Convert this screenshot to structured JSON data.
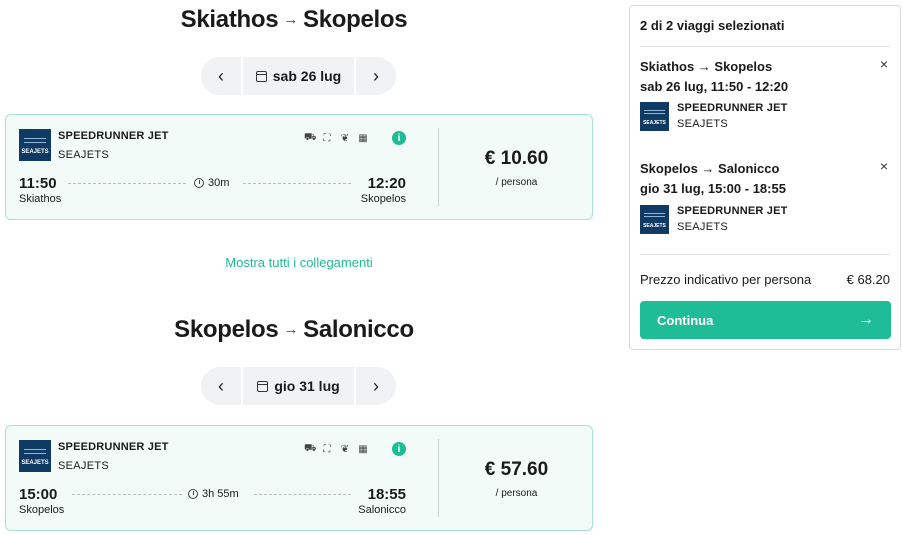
{
  "journeys": [
    {
      "route": {
        "from": "Skiathos",
        "to": "Skopelos",
        "arrow": "→"
      },
      "date_nav": {
        "prev_icon": "‹",
        "date": "sab 26 lug",
        "next_icon": "›"
      },
      "result": {
        "logo_text": "SEAJETS",
        "vessel": "SPEEDRUNNER JET",
        "operator": "SEAJETS",
        "amenities": [
          "car-icon",
          "seat-icon",
          "pet-icon",
          "qr-icon"
        ],
        "departure_time": "11:50",
        "departure_port": "Skiathos",
        "duration": "30m",
        "arrival_time": "12:20",
        "arrival_port": "Skopelos",
        "price": "€ 10.60",
        "price_unit": "/ persona"
      }
    },
    {
      "route": {
        "from": "Skopelos",
        "to": "Salonicco",
        "arrow": "→"
      },
      "date_nav": {
        "prev_icon": "‹",
        "date": "gio 31 lug",
        "next_icon": "›"
      },
      "result": {
        "logo_text": "SEAJETS",
        "vessel": "SPEEDRUNNER JET",
        "operator": "SEAJETS",
        "amenities": [
          "car-icon",
          "seat-icon",
          "pet-icon",
          "qr-icon"
        ],
        "departure_time": "15:00",
        "departure_port": "Skopelos",
        "duration": "3h 55m",
        "arrival_time": "18:55",
        "arrival_port": "Salonicco",
        "price": "€ 57.60",
        "price_unit": "/ persona"
      }
    }
  ],
  "show_all_link": "Mostra tutti i collegamenti",
  "summary": {
    "header": "2 di 2 viaggi selezionati",
    "trips": [
      {
        "route": "Skiathos → Skopelos",
        "datetime": "sab 26 lug, 11:50 - 12:20",
        "vessel": "SPEEDRUNNER JET",
        "operator": "SEAJETS",
        "logo_text": "SEAJETS"
      },
      {
        "route": "Skopelos → Salonicco",
        "datetime": "gio 31 lug, 15:00 - 18:55",
        "vessel": "SPEEDRUNNER JET",
        "operator": "SEAJETS",
        "logo_text": "SEAJETS"
      }
    ],
    "remove_icon": "×",
    "total_label": "Prezzo indicativo per persona",
    "total_value": "€ 68.20",
    "continue_label": "Continua",
    "continue_arrow": "→"
  },
  "colors": {
    "accent": "#1ebc97",
    "card_bg": "#f2fbf8",
    "card_border": "#a8e2d1",
    "logo_bg": "#0e3a63"
  }
}
